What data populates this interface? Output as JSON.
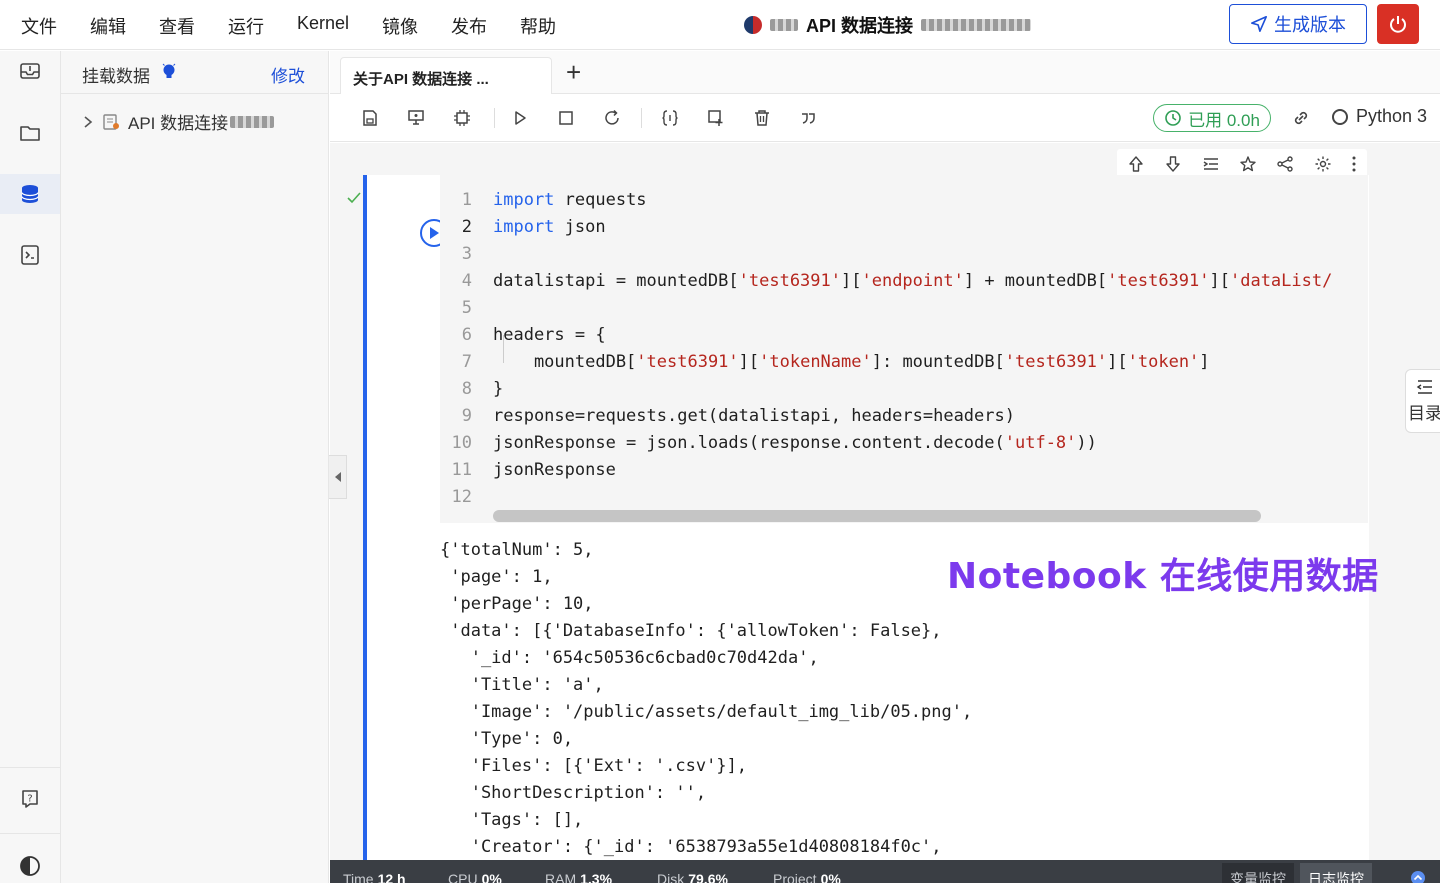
{
  "menu": {
    "items": [
      "文件",
      "编辑",
      "查看",
      "运行",
      "Kernel",
      "镜像",
      "发布",
      "帮助"
    ]
  },
  "header": {
    "title": "API 数据连接",
    "generate_label": "生成版本"
  },
  "panel": {
    "title": "挂载数据",
    "edit_label": "修改",
    "tree_item": "API 数据连接 "
  },
  "tabs": {
    "active_label": "关于API 数据连接 ...",
    "add_label": "+"
  },
  "toolbar": {
    "usage_label": "已用 0.0h",
    "kernel_label": "Python 3"
  },
  "code_lines": [
    {
      "n": "1",
      "parts": [
        [
          "kw",
          "import"
        ],
        [
          "",
          " requests"
        ]
      ]
    },
    {
      "n": "2",
      "parts": [
        [
          "kw",
          "import"
        ],
        [
          "",
          " json"
        ]
      ]
    },
    {
      "n": "3",
      "parts": []
    },
    {
      "n": "4",
      "parts": [
        [
          "",
          "datalistapi = mountedDB["
        ],
        [
          "str",
          "'test6391'"
        ],
        [
          "",
          "]["
        ],
        [
          "str",
          "'endpoint'"
        ],
        [
          "",
          "] + mountedDB["
        ],
        [
          "str",
          "'test6391'"
        ],
        [
          "",
          "]["
        ],
        [
          "str",
          "'dataList/"
        ]
      ]
    },
    {
      "n": "5",
      "parts": []
    },
    {
      "n": "6",
      "parts": [
        [
          "",
          "headers = {"
        ]
      ]
    },
    {
      "n": "7",
      "parts": [
        [
          "",
          "    mountedDB["
        ],
        [
          "str",
          "'test6391'"
        ],
        [
          "",
          "]["
        ],
        [
          "str",
          "'tokenName'"
        ],
        [
          "",
          "]: mountedDB["
        ],
        [
          "str",
          "'test6391'"
        ],
        [
          "",
          "]["
        ],
        [
          "str",
          "'token'"
        ],
        [
          "",
          "]"
        ]
      ]
    },
    {
      "n": "8",
      "parts": [
        [
          "",
          "}"
        ]
      ]
    },
    {
      "n": "9",
      "parts": [
        [
          "",
          "response=requests.get(datalistapi, headers=headers)"
        ]
      ]
    },
    {
      "n": "10",
      "parts": [
        [
          "",
          "jsonResponse = json.loads(response.content.decode("
        ],
        [
          "str",
          "'utf-8'"
        ],
        [
          "",
          "))"
        ]
      ]
    },
    {
      "n": "11",
      "parts": [
        [
          "",
          "jsonResponse"
        ]
      ]
    },
    {
      "n": "12",
      "parts": []
    }
  ],
  "current_line": "2",
  "output_lines": [
    "{'totalNum': 5,",
    " 'page': 1,",
    " 'perPage': 10,",
    " 'data': [{'DatabaseInfo': {'allowToken': False},",
    "   '_id': '654c50536c6cbad0c70d42da',",
    "   'Title': 'a',",
    "   'Image': '/public/assets/default_img_lib/05.png',",
    "   'Type': 0,",
    "   'Files': [{'Ext': '.csv'}],",
    "   'ShortDescription': '',",
    "   'Tags': [],",
    "   'Creator': {'_id': '6538793a55e1d40808184f0c',"
  ],
  "overlay_caption": "Notebook 在线使用数据",
  "toc_label": "目录",
  "status": {
    "time_label": "Time",
    "time_value": "12 h",
    "cpu_label": "CPU",
    "cpu_value": "0%",
    "ram_label": "RAM",
    "ram_value": "1.3%",
    "disk_label": "Disk",
    "disk_value": "79.6%",
    "project_label": "Project",
    "project_value": "0%",
    "tab_vars": "变量监控",
    "tab_logs": "日志监控"
  },
  "colors": {
    "accent": "#1d4fd8",
    "danger": "#d93025",
    "success": "#2f9e55",
    "keyword": "#2563eb",
    "string": "#b5261e",
    "caption": "#7c3aed"
  }
}
